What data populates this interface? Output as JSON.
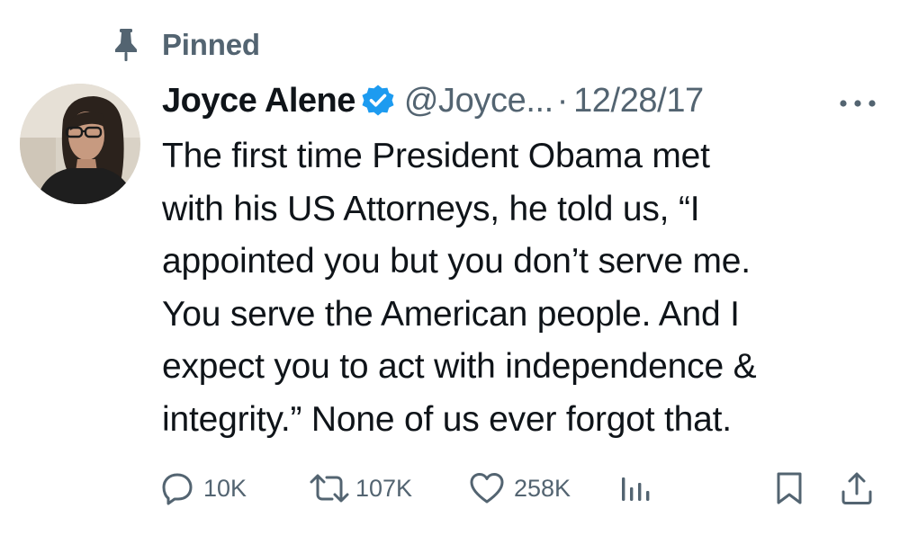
{
  "pinned": {
    "label": "Pinned",
    "icon": "pin-icon"
  },
  "tweet": {
    "author_name": "Joyce Alene",
    "verified_icon": "verified-badge-icon",
    "handle": "@Joyce...",
    "separator": "·",
    "date": "12/28/17",
    "more_icon": "more-options-icon",
    "text_lines": [
      "The first time President Obama met",
      "with his US Attorneys, he told us, “I",
      "appointed you but you don’t serve me.",
      "You serve the American people. And I",
      "expect you to act with independence &",
      "integrity.” None of us ever forgot that."
    ]
  },
  "actions": {
    "reply": {
      "icon": "reply-icon",
      "count": "10K"
    },
    "retweet": {
      "icon": "retweet-icon",
      "count": "107K"
    },
    "like": {
      "icon": "heart-icon",
      "count": "258K"
    },
    "views": {
      "icon": "views-chart-icon"
    },
    "bookmark": {
      "icon": "bookmark-icon"
    },
    "share": {
      "icon": "share-icon"
    }
  },
  "colors": {
    "text_primary": "#0f1419",
    "text_secondary": "#536471",
    "verified_blue": "#1d9bf0",
    "background": "#ffffff"
  }
}
